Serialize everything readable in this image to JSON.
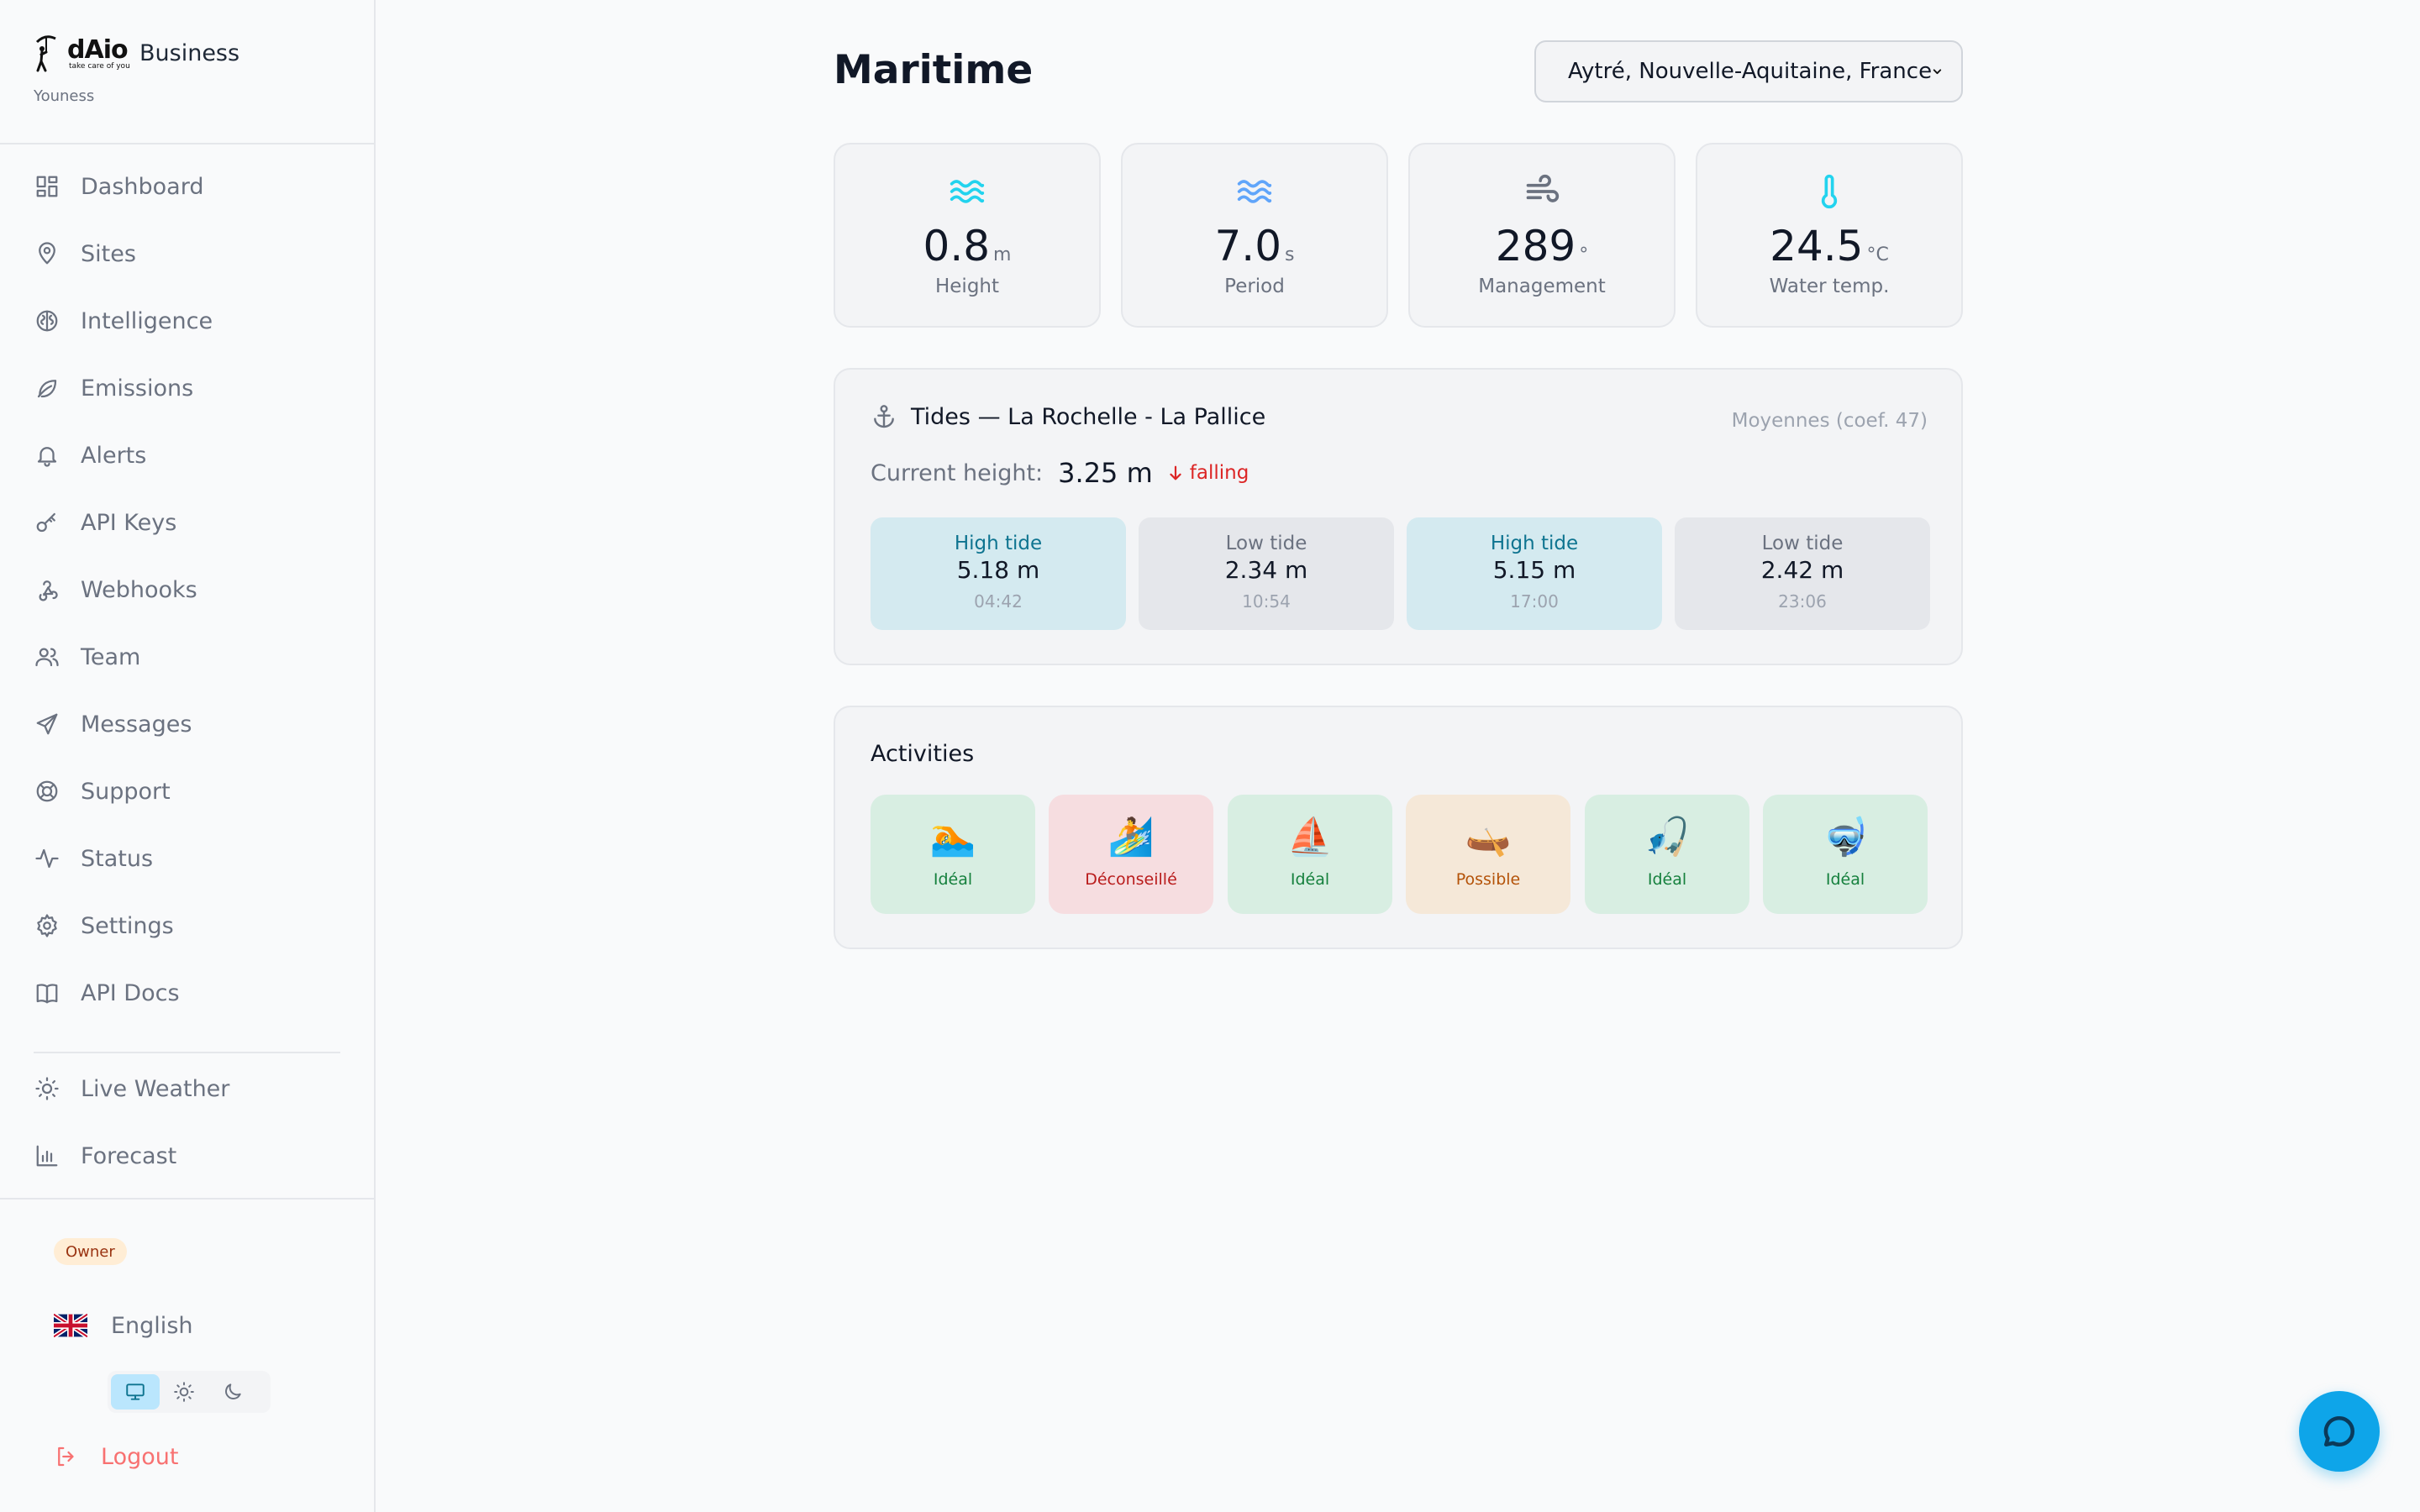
{
  "brand": {
    "name": "dAio",
    "tagline": "take care of you",
    "product": "Business",
    "user": "Youness"
  },
  "sidebar": {
    "items": [
      {
        "label": "Dashboard",
        "icon": "dashboard-icon"
      },
      {
        "label": "Sites",
        "icon": "map-pin-icon"
      },
      {
        "label": "Intelligence",
        "icon": "brain-icon"
      },
      {
        "label": "Emissions",
        "icon": "leaf-icon"
      },
      {
        "label": "Alerts",
        "icon": "bell-icon"
      },
      {
        "label": "API Keys",
        "icon": "key-icon"
      },
      {
        "label": "Webhooks",
        "icon": "webhook-icon"
      },
      {
        "label": "Team",
        "icon": "users-icon"
      },
      {
        "label": "Messages",
        "icon": "send-icon"
      },
      {
        "label": "Support",
        "icon": "life-buoy-icon"
      },
      {
        "label": "Status",
        "icon": "activity-icon"
      },
      {
        "label": "Settings",
        "icon": "gear-icon"
      },
      {
        "label": "API Docs",
        "icon": "book-icon"
      }
    ],
    "extra_items": [
      {
        "label": "Live Weather",
        "icon": "sun-icon"
      },
      {
        "label": "Forecast",
        "icon": "bar-chart-icon"
      }
    ],
    "role_badge": "Owner",
    "language": "English",
    "theme_selected": "system",
    "logout": "Logout"
  },
  "main": {
    "title": "Maritime",
    "location": "Aytré, Nouvelle-Aquitaine, France",
    "stats": [
      {
        "value": "0.8",
        "unit": "m",
        "label": "Height",
        "icon": "waves-icon",
        "color": "#22d3ee"
      },
      {
        "value": "7.0",
        "unit": "s",
        "label": "Period",
        "icon": "waves-icon",
        "color": "#60a5fa"
      },
      {
        "value": "289",
        "unit": "°",
        "label": "Management",
        "icon": "wind-icon",
        "color": "#6b7280"
      },
      {
        "value": "24.5",
        "unit": "°C",
        "label": "Water temp.",
        "icon": "thermometer-icon",
        "color": "#22d3ee"
      }
    ],
    "tides": {
      "title": "Tides — La Rochelle - La Pallice",
      "coef": "Moyennes (coef. 47)",
      "current_label": "Current height:",
      "current_value": "3.25 m",
      "trend": "falling",
      "events": [
        {
          "type": "High tide",
          "height": "5.18 m",
          "time": "04:42",
          "kind": "high"
        },
        {
          "type": "Low tide",
          "height": "2.34 m",
          "time": "10:54",
          "kind": "low"
        },
        {
          "type": "High tide",
          "height": "5.15 m",
          "time": "17:00",
          "kind": "high"
        },
        {
          "type": "Low tide",
          "height": "2.42 m",
          "time": "23:06",
          "kind": "low"
        }
      ]
    },
    "activities": {
      "title": "Activities",
      "items": [
        {
          "emoji": "🏊",
          "status": "Idéal",
          "level": "good"
        },
        {
          "emoji": "🏄",
          "status": "Déconseillé",
          "level": "bad"
        },
        {
          "emoji": "⛵",
          "status": "Idéal",
          "level": "good"
        },
        {
          "emoji": "🛶",
          "status": "Possible",
          "level": "ok"
        },
        {
          "emoji": "🎣",
          "status": "Idéal",
          "level": "good"
        },
        {
          "emoji": "🤿",
          "status": "Idéal",
          "level": "good"
        }
      ]
    }
  },
  "colors": {
    "accent": "#0ea5e9",
    "good": "#15803d",
    "bad": "#b91c1c",
    "ok": "#b45309"
  }
}
